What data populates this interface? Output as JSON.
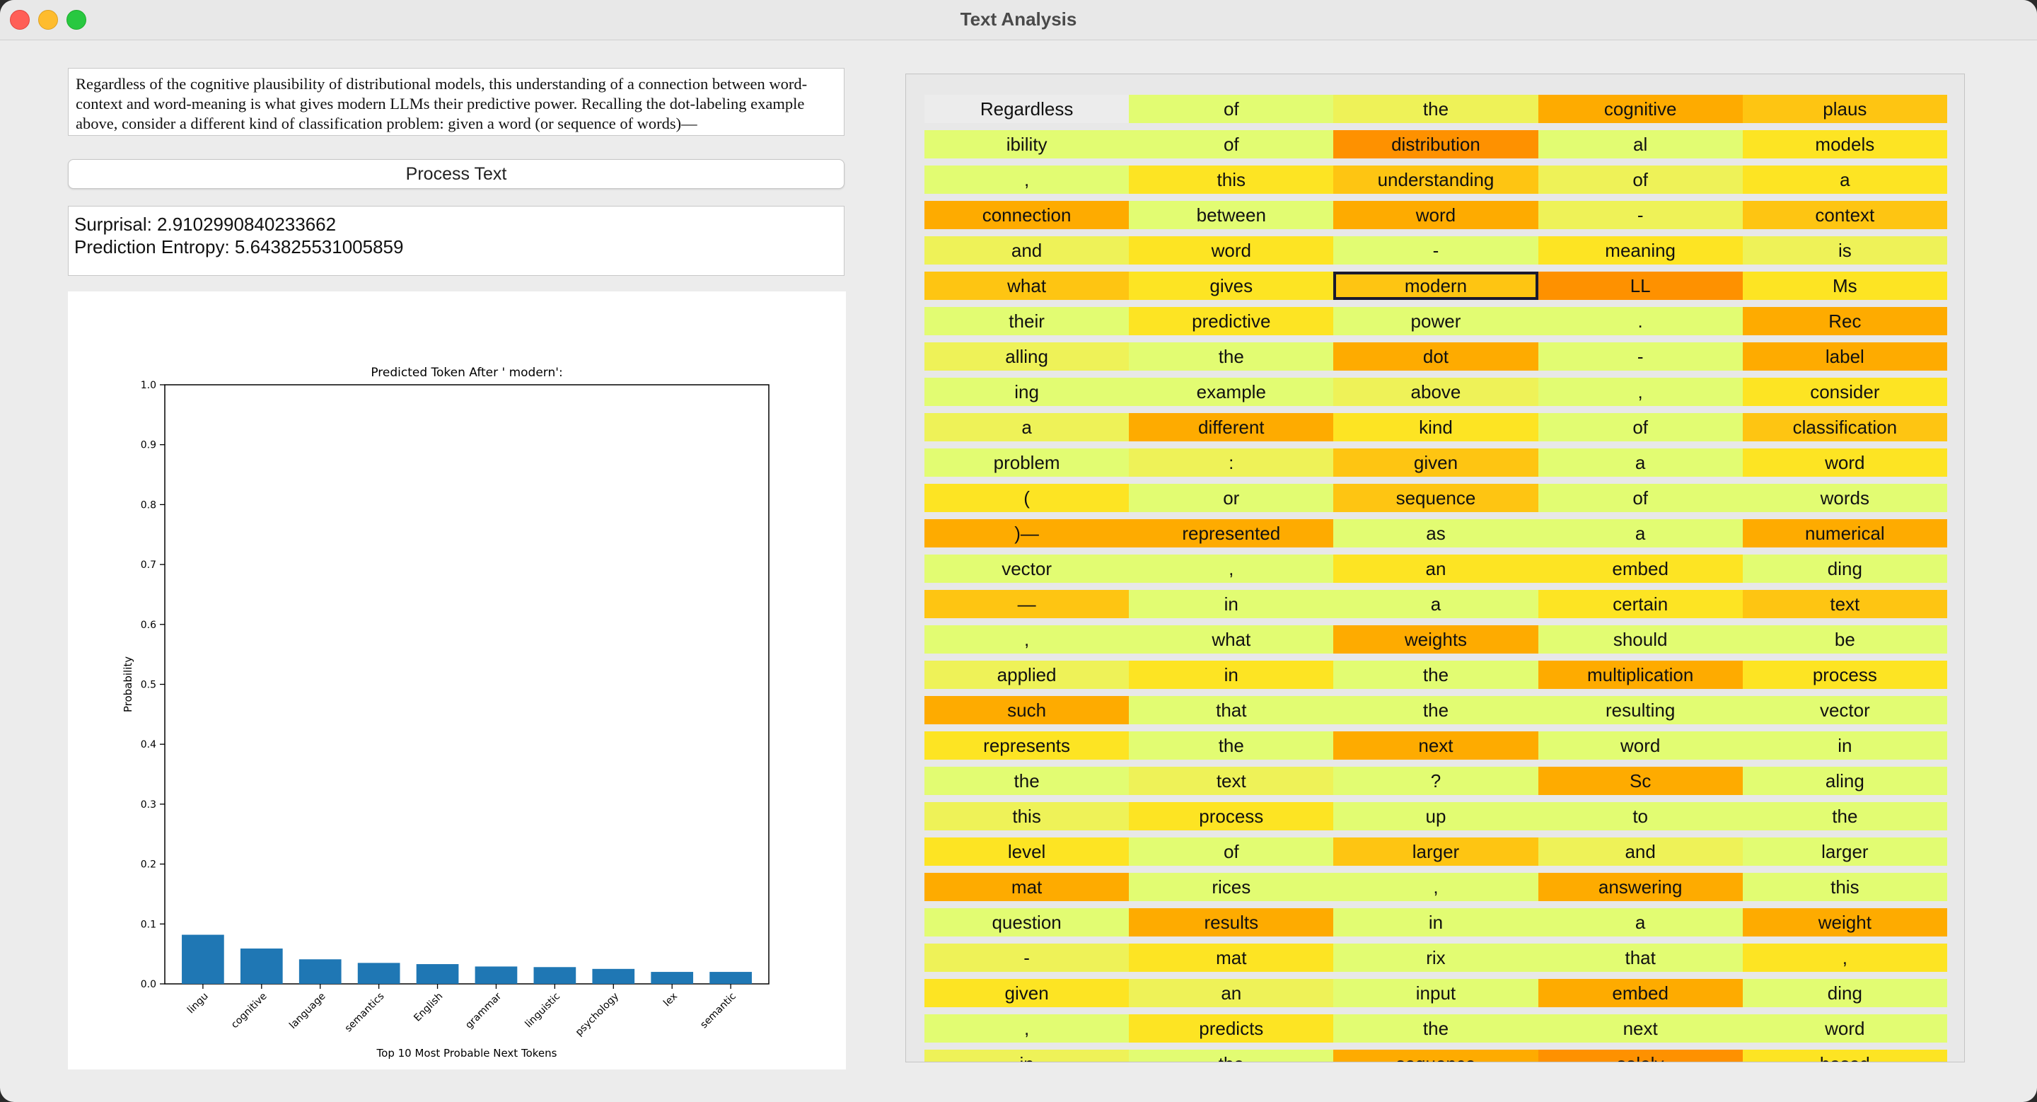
{
  "window": {
    "title": "Text Analysis"
  },
  "input_text": "Regardless of the cognitive plausibility of distributional models, this understanding of a connection between word-context and word-meaning is what gives modern LLMs their predictive power. Recalling the dot-labeling example above, consider a different kind of classification problem: given a word (or sequence of words)—",
  "process_button_label": "Process Text",
  "stats": {
    "surprisal": "Surprisal: 2.9102990840233662",
    "entropy": "Prediction Entropy: 5.643825531005859"
  },
  "chart_data": {
    "type": "bar",
    "title": "Predicted Token After ' modern':",
    "xlabel": "Top 10 Most Probable Next Tokens",
    "ylabel": "Probability",
    "categories": [
      "lingu",
      "cognitive",
      "language",
      "semantics",
      "English",
      "grammar",
      "linguistic",
      "psychology",
      "lex",
      "semantic"
    ],
    "values": [
      0.082,
      0.059,
      0.041,
      0.035,
      0.033,
      0.029,
      0.028,
      0.025,
      0.02,
      0.02
    ],
    "ylim": [
      0,
      1.0
    ],
    "yticks": [
      "0.0",
      "0.1",
      "0.2",
      "0.3",
      "0.4",
      "0.5",
      "0.6",
      "0.7",
      "0.8",
      "0.9",
      "1.0"
    ],
    "bar_color": "#1f77b4",
    "grid": false
  },
  "heatmap_colors": {
    "light": "#e2fc72",
    "pale_yellow": "#eef258",
    "yellow": "#fde423",
    "gold": "#fec512",
    "orange": "#feab00",
    "deep_orange": "#fe9100"
  },
  "tokens": [
    {
      "text": "Regardless",
      "c": "#ececec"
    },
    {
      "text": "of",
      "c": "#e2fc72"
    },
    {
      "text": "the",
      "c": "#eef258"
    },
    {
      "text": "cognitive",
      "c": "#feab00"
    },
    {
      "text": "plaus",
      "c": "#fec512"
    },
    {
      "text": "ibility",
      "c": "#e2fc72"
    },
    {
      "text": "of",
      "c": "#e2fc72"
    },
    {
      "text": "distribution",
      "c": "#fe9100"
    },
    {
      "text": "al",
      "c": "#e2fc72"
    },
    {
      "text": "models",
      "c": "#fde423"
    },
    {
      "text": ",",
      "c": "#e2fc72"
    },
    {
      "text": "this",
      "c": "#fde423"
    },
    {
      "text": "understanding",
      "c": "#fec512"
    },
    {
      "text": "of",
      "c": "#eef258"
    },
    {
      "text": "a",
      "c": "#fde423"
    },
    {
      "text": "connection",
      "c": "#feab00"
    },
    {
      "text": "between",
      "c": "#e2fc72"
    },
    {
      "text": "word",
      "c": "#feab00"
    },
    {
      "text": "-",
      "c": "#eef258"
    },
    {
      "text": "context",
      "c": "#fec512"
    },
    {
      "text": "and",
      "c": "#eef258"
    },
    {
      "text": "word",
      "c": "#fde423"
    },
    {
      "text": "-",
      "c": "#e2fc72"
    },
    {
      "text": "meaning",
      "c": "#fde423"
    },
    {
      "text": "is",
      "c": "#eef258"
    },
    {
      "text": "what",
      "c": "#fec512"
    },
    {
      "text": "gives",
      "c": "#fde423"
    },
    {
      "text": "modern",
      "c": "#fec512",
      "selected": true
    },
    {
      "text": "LL",
      "c": "#fe9100"
    },
    {
      "text": "Ms",
      "c": "#fde423"
    },
    {
      "text": "their",
      "c": "#e2fc72"
    },
    {
      "text": "predictive",
      "c": "#fde423"
    },
    {
      "text": "power",
      "c": "#e2fc72"
    },
    {
      "text": ".",
      "c": "#e2fc72"
    },
    {
      "text": "Rec",
      "c": "#feab00"
    },
    {
      "text": "alling",
      "c": "#eef258"
    },
    {
      "text": "the",
      "c": "#e2fc72"
    },
    {
      "text": "dot",
      "c": "#feab00"
    },
    {
      "text": "-",
      "c": "#e2fc72"
    },
    {
      "text": "label",
      "c": "#feab00"
    },
    {
      "text": "ing",
      "c": "#e2fc72"
    },
    {
      "text": "example",
      "c": "#e2fc72"
    },
    {
      "text": "above",
      "c": "#eef258"
    },
    {
      "text": ",",
      "c": "#e2fc72"
    },
    {
      "text": "consider",
      "c": "#fde423"
    },
    {
      "text": "a",
      "c": "#eef258"
    },
    {
      "text": "different",
      "c": "#feab00"
    },
    {
      "text": "kind",
      "c": "#fde423"
    },
    {
      "text": "of",
      "c": "#e2fc72"
    },
    {
      "text": "classification",
      "c": "#fec512"
    },
    {
      "text": "problem",
      "c": "#e2fc72"
    },
    {
      "text": ":",
      "c": "#eef258"
    },
    {
      "text": "given",
      "c": "#fec512"
    },
    {
      "text": "a",
      "c": "#e2fc72"
    },
    {
      "text": "word",
      "c": "#fde423"
    },
    {
      "text": "(",
      "c": "#fde423"
    },
    {
      "text": "or",
      "c": "#e2fc72"
    },
    {
      "text": "sequence",
      "c": "#fec512"
    },
    {
      "text": "of",
      "c": "#e2fc72"
    },
    {
      "text": "words",
      "c": "#e2fc72"
    },
    {
      "text": ")—",
      "c": "#feab00"
    },
    {
      "text": "represented",
      "c": "#feab00"
    },
    {
      "text": "as",
      "c": "#e2fc72"
    },
    {
      "text": "a",
      "c": "#e2fc72"
    },
    {
      "text": "numerical",
      "c": "#feab00"
    },
    {
      "text": "vector",
      "c": "#e2fc72"
    },
    {
      "text": ",",
      "c": "#e2fc72"
    },
    {
      "text": "an",
      "c": "#fde423"
    },
    {
      "text": "embed",
      "c": "#fde423"
    },
    {
      "text": "ding",
      "c": "#e2fc72"
    },
    {
      "text": "—",
      "c": "#fec512"
    },
    {
      "text": "in",
      "c": "#e2fc72"
    },
    {
      "text": "a",
      "c": "#e2fc72"
    },
    {
      "text": "certain",
      "c": "#fde423"
    },
    {
      "text": "text",
      "c": "#fec512"
    },
    {
      "text": ",",
      "c": "#e2fc72"
    },
    {
      "text": "what",
      "c": "#e2fc72"
    },
    {
      "text": "weights",
      "c": "#feab00"
    },
    {
      "text": "should",
      "c": "#e2fc72"
    },
    {
      "text": "be",
      "c": "#e2fc72"
    },
    {
      "text": "applied",
      "c": "#eef258"
    },
    {
      "text": "in",
      "c": "#fde423"
    },
    {
      "text": "the",
      "c": "#e2fc72"
    },
    {
      "text": "multiplication",
      "c": "#feab00"
    },
    {
      "text": "process",
      "c": "#fde423"
    },
    {
      "text": "such",
      "c": "#feab00"
    },
    {
      "text": "that",
      "c": "#e2fc72"
    },
    {
      "text": "the",
      "c": "#e2fc72"
    },
    {
      "text": "resulting",
      "c": "#e2fc72"
    },
    {
      "text": "vector",
      "c": "#e2fc72"
    },
    {
      "text": "represents",
      "c": "#fde423"
    },
    {
      "text": "the",
      "c": "#e2fc72"
    },
    {
      "text": "next",
      "c": "#feab00"
    },
    {
      "text": "word",
      "c": "#e2fc72"
    },
    {
      "text": "in",
      "c": "#e2fc72"
    },
    {
      "text": "the",
      "c": "#e2fc72"
    },
    {
      "text": "text",
      "c": "#eef258"
    },
    {
      "text": "?",
      "c": "#e2fc72"
    },
    {
      "text": "Sc",
      "c": "#feab00"
    },
    {
      "text": "aling",
      "c": "#e2fc72"
    },
    {
      "text": "this",
      "c": "#eef258"
    },
    {
      "text": "process",
      "c": "#fde423"
    },
    {
      "text": "up",
      "c": "#e2fc72"
    },
    {
      "text": "to",
      "c": "#e2fc72"
    },
    {
      "text": "the",
      "c": "#e2fc72"
    },
    {
      "text": "level",
      "c": "#fde423"
    },
    {
      "text": "of",
      "c": "#e2fc72"
    },
    {
      "text": "larger",
      "c": "#fec512"
    },
    {
      "text": "and",
      "c": "#eef258"
    },
    {
      "text": "larger",
      "c": "#e2fc72"
    },
    {
      "text": "mat",
      "c": "#feab00"
    },
    {
      "text": "rices",
      "c": "#e2fc72"
    },
    {
      "text": ",",
      "c": "#e2fc72"
    },
    {
      "text": "answering",
      "c": "#feab00"
    },
    {
      "text": "this",
      "c": "#e2fc72"
    },
    {
      "text": "question",
      "c": "#e2fc72"
    },
    {
      "text": "results",
      "c": "#feab00"
    },
    {
      "text": "in",
      "c": "#e2fc72"
    },
    {
      "text": "a",
      "c": "#e2fc72"
    },
    {
      "text": "weight",
      "c": "#feab00"
    },
    {
      "text": "-",
      "c": "#eef258"
    },
    {
      "text": "mat",
      "c": "#fde423"
    },
    {
      "text": "rix",
      "c": "#e2fc72"
    },
    {
      "text": "that",
      "c": "#e2fc72"
    },
    {
      "text": ",",
      "c": "#fde423"
    },
    {
      "text": "given",
      "c": "#fde423"
    },
    {
      "text": "an",
      "c": "#eef258"
    },
    {
      "text": "input",
      "c": "#e2fc72"
    },
    {
      "text": "embed",
      "c": "#feab00"
    },
    {
      "text": "ding",
      "c": "#e2fc72"
    },
    {
      "text": ",",
      "c": "#e2fc72"
    },
    {
      "text": "predicts",
      "c": "#fde423"
    },
    {
      "text": "the",
      "c": "#e2fc72"
    },
    {
      "text": "next",
      "c": "#e2fc72"
    },
    {
      "text": "word",
      "c": "#e2fc72"
    },
    {
      "text": "in",
      "c": "#eef258"
    },
    {
      "text": "the",
      "c": "#e2fc72"
    },
    {
      "text": "sequence",
      "c": "#feab00"
    },
    {
      "text": "solely",
      "c": "#fe9100"
    },
    {
      "text": "based",
      "c": "#fde423"
    }
  ]
}
